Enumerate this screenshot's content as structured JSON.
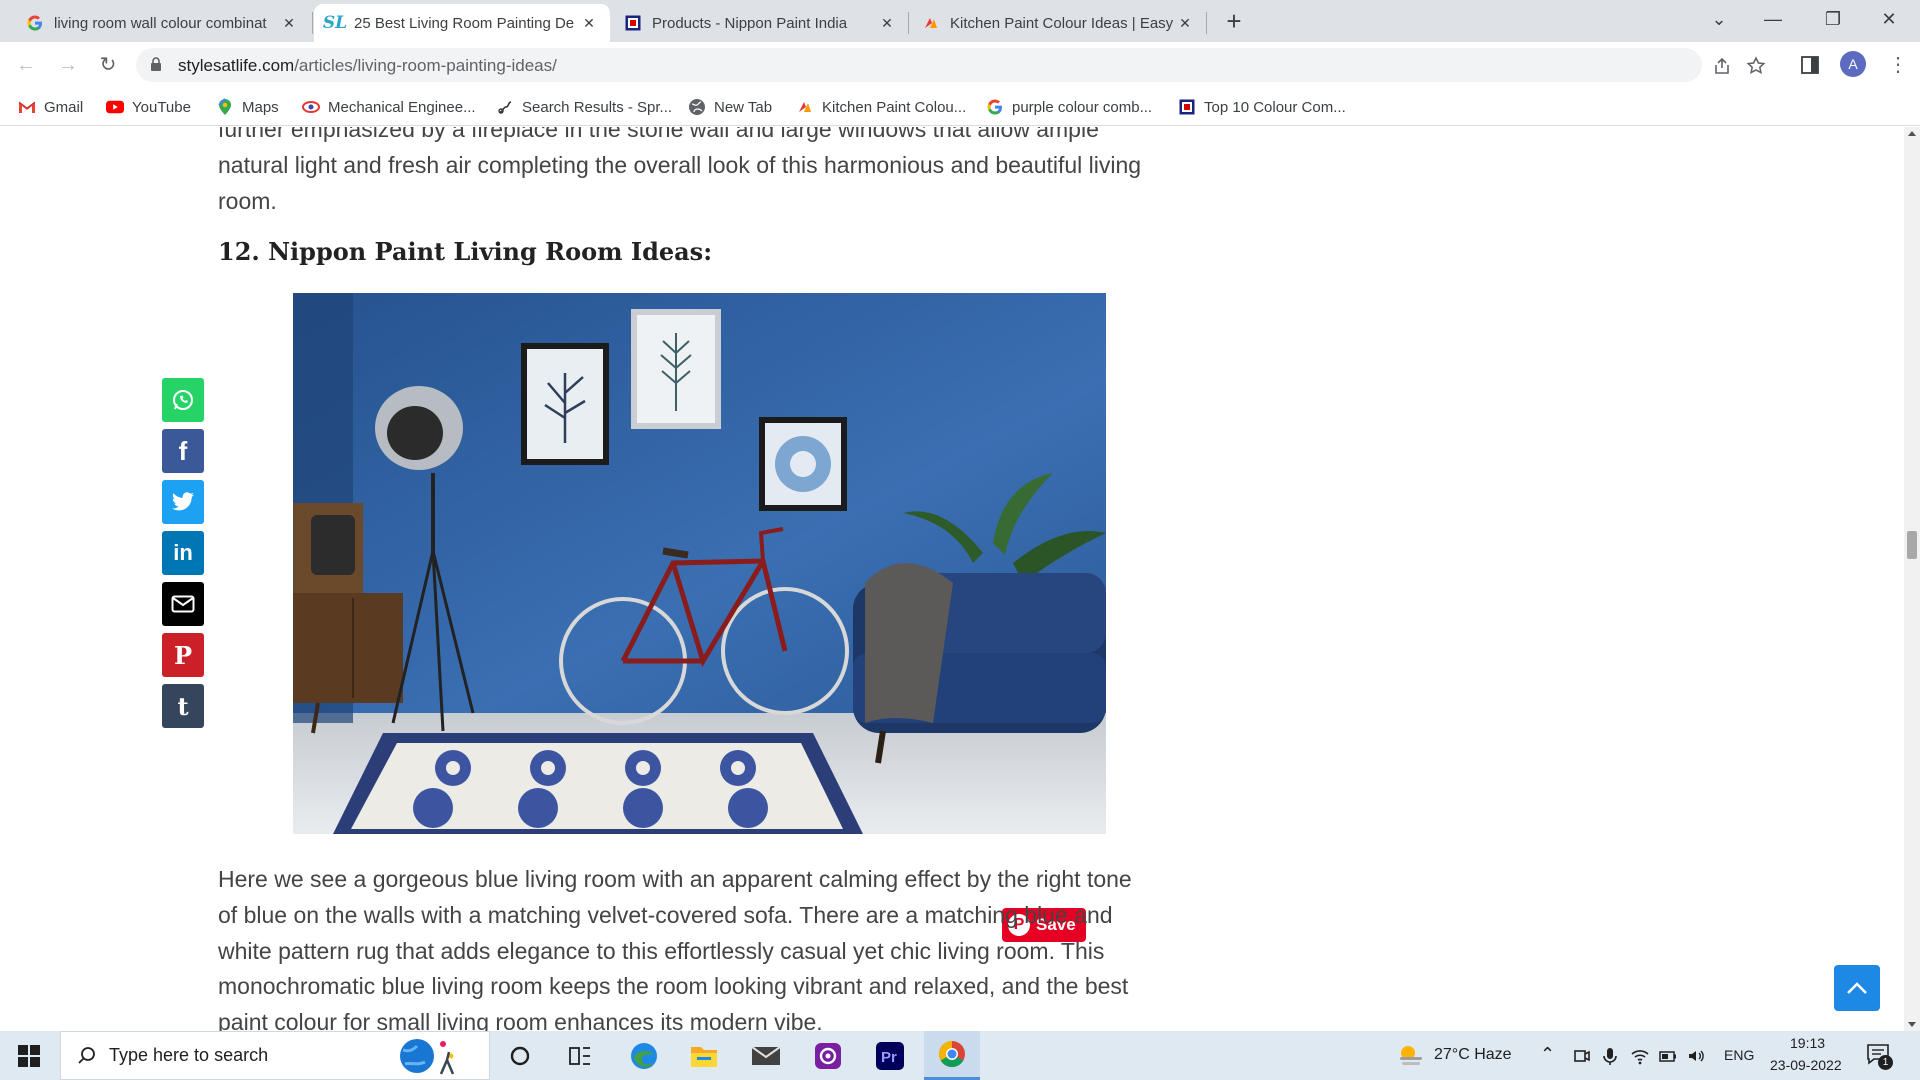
{
  "browser": {
    "tabs": [
      {
        "title": "living room wall colour combinat",
        "icon": "google-g-icon",
        "active": false
      },
      {
        "title": "25 Best Living Room Painting De",
        "icon": "stylesatlife-icon",
        "active": true
      },
      {
        "title": "Products - Nippon Paint India",
        "icon": "nippon-paint-icon",
        "active": false
      },
      {
        "title": "Kitchen Paint Colour Ideas | Easy",
        "icon": "asian-paints-icon",
        "active": false
      }
    ],
    "url": {
      "host": "stylesatlife.com",
      "path": "/articles/living-room-painting-ideas/"
    },
    "profile_initial": "A",
    "bookmarks": [
      {
        "label": "Gmail",
        "icon": "gmail-icon"
      },
      {
        "label": "YouTube",
        "icon": "youtube-icon"
      },
      {
        "label": "Maps",
        "icon": "maps-icon"
      },
      {
        "label": "Mechanical Enginee...",
        "icon": "mechanical-icon"
      },
      {
        "label": "Search Results - Spr...",
        "icon": "springer-icon"
      },
      {
        "label": "New Tab",
        "icon": "globe-icon"
      },
      {
        "label": "Kitchen Paint Colou...",
        "icon": "asian-paints-icon"
      },
      {
        "label": "purple colour comb...",
        "icon": "google-g-icon"
      },
      {
        "label": "Top 10 Colour Com...",
        "icon": "nippon-paint-icon"
      }
    ]
  },
  "article": {
    "top_partial": "further emphasized by a fireplace in the stone wall and large windows that allow ample",
    "top_line1": "natural light and fresh air completing the overall look of this harmonious and beautiful living",
    "top_line2": "room.",
    "heading": "12. Nippon Paint Living Room Ideas:",
    "pin_save_label": "Save",
    "body_lines": [
      "Here we see a gorgeous blue living room with an apparent calming effect by the right tone",
      "of blue on the walls with a matching velvet-covered sofa. There are a matching blue and",
      "white pattern rug that adds elegance to this effortlessly casual yet chic living room. This",
      "monochromatic blue living room keeps the room looking vibrant and relaxed, and the best",
      "paint colour for small living room enhances its modern vibe."
    ],
    "share_buttons": [
      {
        "name": "whatsapp",
        "color": "#25d366"
      },
      {
        "name": "facebook",
        "color": "#3b5998"
      },
      {
        "name": "twitter",
        "color": "#1da1f2"
      },
      {
        "name": "linkedin",
        "color": "#0077b5"
      },
      {
        "name": "email",
        "color": "#000000"
      },
      {
        "name": "pinterest",
        "color": "#cb2027"
      },
      {
        "name": "tumblr",
        "color": "#35465c"
      }
    ]
  },
  "taskbar": {
    "search_placeholder": "Type here to search",
    "weather": "27°C  Haze",
    "language": "ENG",
    "time": "19:13",
    "date": "23-09-2022",
    "notification_count": "1"
  }
}
